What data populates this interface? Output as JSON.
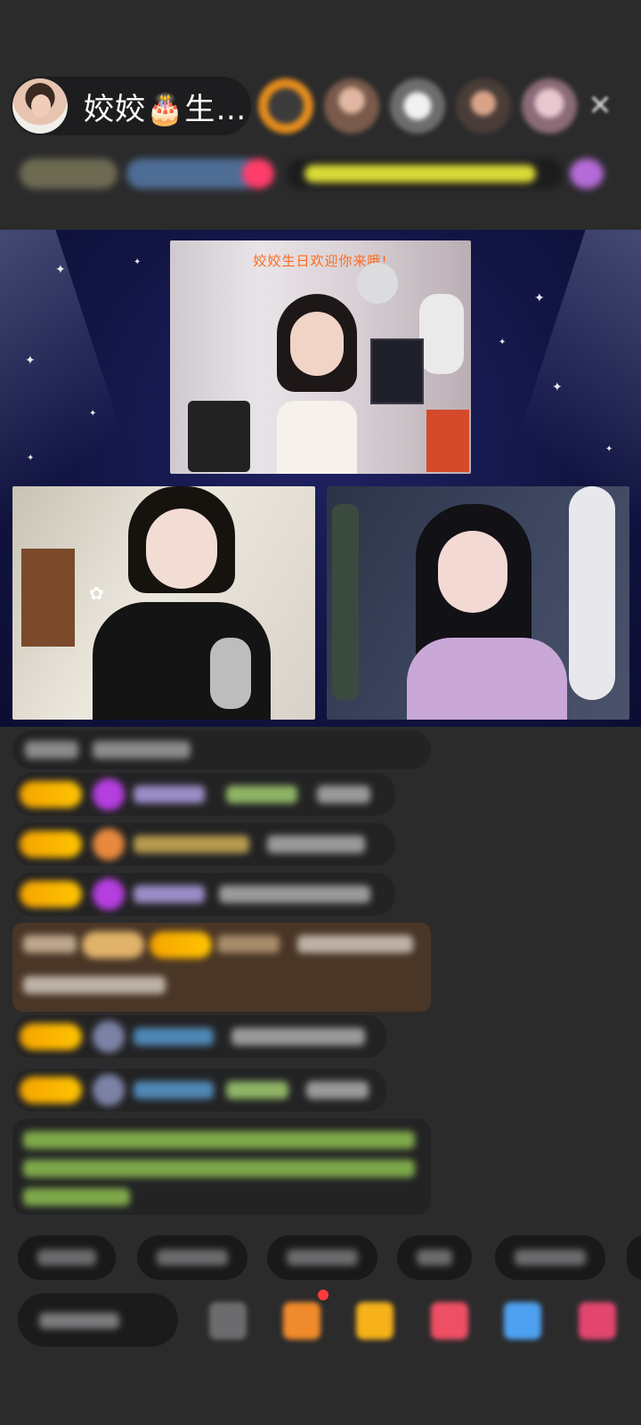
{
  "header": {
    "host_name": "姣姣🎂生…"
  },
  "stage": {
    "caption": "姣姣生日欢迎你来哦!"
  }
}
